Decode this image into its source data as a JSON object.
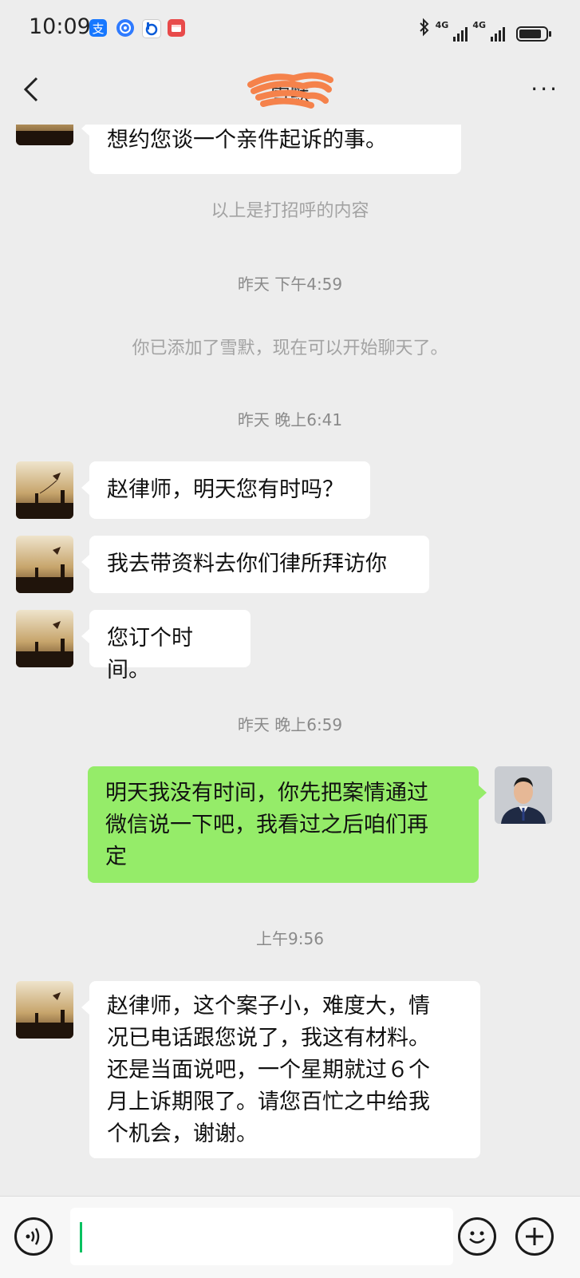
{
  "status_bar": {
    "time": "10:09",
    "network_1": "4G",
    "network_2": "4G",
    "app_icons": [
      "alipay-icon",
      "baidu-netdisk-icon",
      "bilibili-icon",
      "calendar-app-icon"
    ],
    "battery_percent": 76
  },
  "nav": {
    "title": "雪默",
    "more_label": "···"
  },
  "chat": {
    "partial_message": "想约您谈一个亲件起诉的事。",
    "system_greeting": "以上是打招呼的内容",
    "time_1": "昨天 下午4:59",
    "system_added": "你已添加了雪默，现在可以开始聊天了。",
    "time_2": "昨天 晚上6:41",
    "msg_1": "赵律师，明天您有时吗？",
    "msg_2": "我去带资料去你们律所拜访你",
    "msg_3": "您订个时间。",
    "time_3": "昨天 晚上6:59",
    "msg_out_lines": [
      "明天我没有时间，你先把案情通过",
      "微信说一下吧，我看过之后咱们再",
      "定"
    ],
    "time_4": "上午9:56",
    "msg_4_lines": [
      "赵律师，这个案子小，难度大，情",
      "况已电话跟您说了，我这有材料。",
      "还是当面说吧，一个星期就过６个",
      "月上诉期限了。请您百忙之中给我",
      "个机会，谢谢。"
    ]
  },
  "colors": {
    "background": "#ededed",
    "outgoing_bubble": "#95ec69",
    "incoming_bubble": "#ffffff",
    "caret": "#07c160"
  },
  "input_bar": {
    "voice_icon": "voice-icon",
    "emoji_icon": "emoji-icon",
    "plus_icon": "plus-icon",
    "value": ""
  }
}
